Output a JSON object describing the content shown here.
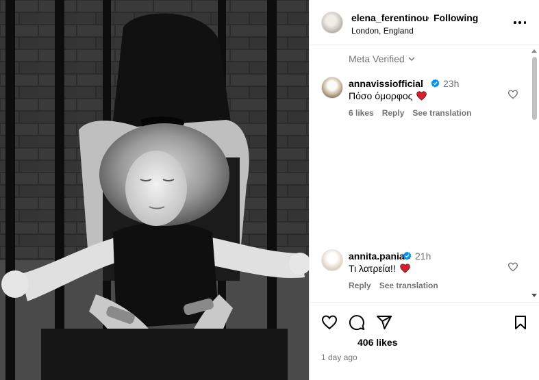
{
  "post": {
    "author": "elena_ferentinou",
    "separator": "•",
    "follow_status": "Following",
    "location": "London, England",
    "more_icon": "more-horizontal-icon"
  },
  "meta_verified": "Meta Verified",
  "comments": [
    {
      "username": "annavissiofficial",
      "verified": true,
      "time": "23h",
      "text": "Πόσο όμορφος",
      "likes": "6 likes",
      "reply": "Reply",
      "translate": "See translation"
    },
    {
      "username": "annita.pania",
      "verified": true,
      "time": "21h",
      "text": "Τι λατρεία!!",
      "reply": "Reply",
      "translate": "See translation"
    }
  ],
  "actions": {
    "like_count": "406 likes",
    "posted_ago": "1 day ago"
  },
  "colors": {
    "verified_blue": "#0095f6",
    "heart_red": "#d8202c",
    "muted": "#737373",
    "divider": "#efefef"
  }
}
